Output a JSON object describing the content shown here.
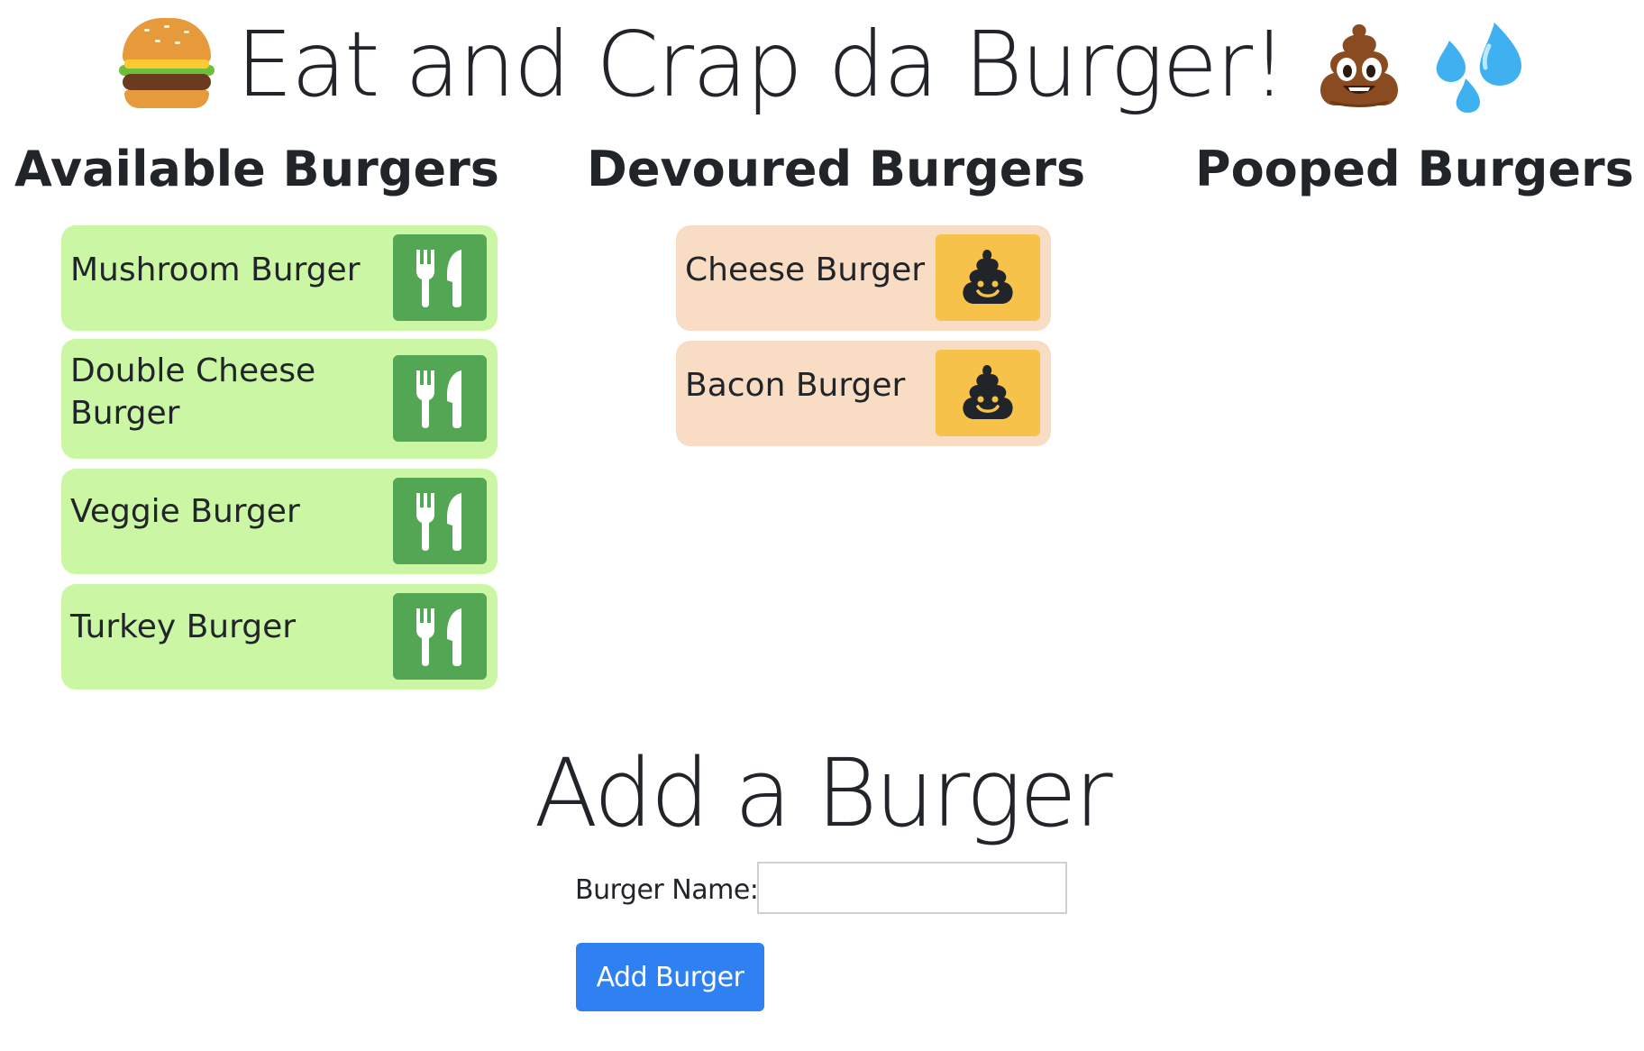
{
  "header": {
    "title": "Eat and Crap da Burger!",
    "leading_emoji": "hamburger-emoji",
    "trailing_emojis": [
      "pile-of-poo-emoji",
      "sweat-droplets-emoji"
    ]
  },
  "columns": {
    "available": {
      "heading": "Available Burgers",
      "button_icon": "utensils-icon",
      "button_color": "#53a653",
      "card_color": "#cbf7a4",
      "items": [
        {
          "name": "Mushroom Burger"
        },
        {
          "name": "Double Cheese Burger"
        },
        {
          "name": "Veggie Burger"
        },
        {
          "name": "Turkey Burger"
        }
      ]
    },
    "devoured": {
      "heading": "Devoured Burgers",
      "button_icon": "poop-icon",
      "button_color": "#f6c24a",
      "card_color": "#f8dcc3",
      "items": [
        {
          "name": "Cheese Burger"
        },
        {
          "name": "Bacon Burger"
        }
      ]
    },
    "pooped": {
      "heading": "Pooped Burgers",
      "items": []
    }
  },
  "form": {
    "heading": "Add a Burger",
    "label": "Burger Name:",
    "input_value": "",
    "input_placeholder": "",
    "submit_label": "Add Burger",
    "submit_color": "#2f80f1"
  }
}
